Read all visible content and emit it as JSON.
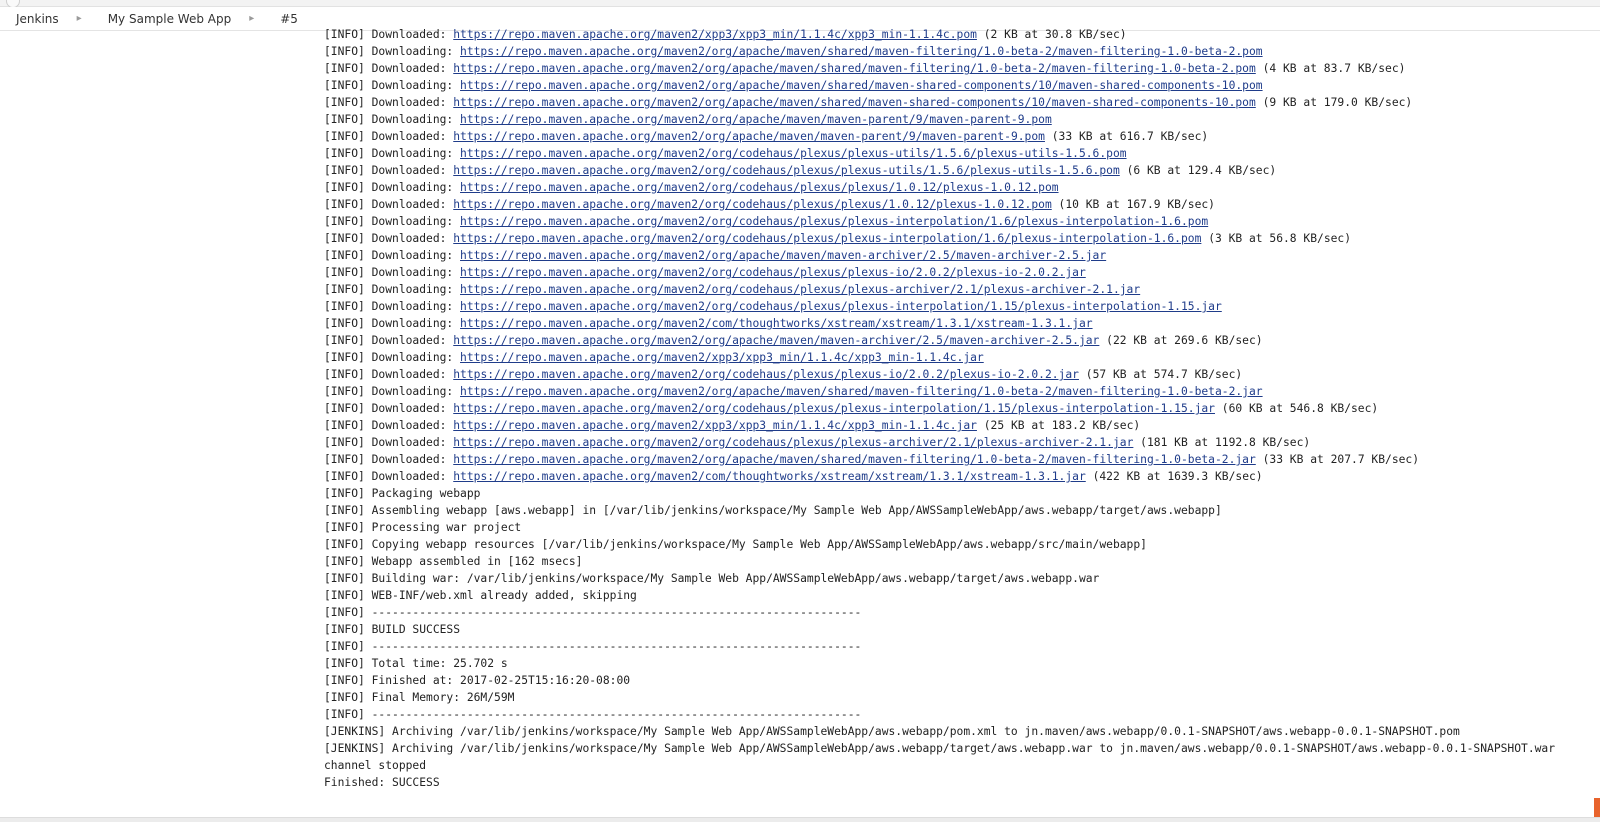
{
  "breadcrumbs": [
    "Jenkins",
    "My Sample Web App",
    "#5"
  ],
  "console": [
    {
      "prefix": "[INFO] Downloaded: ",
      "link": "https://repo.maven.apache.org/maven2/xpp3/xpp3_min/1.1.4c/xpp3_min-1.1.4c.pom",
      "suffix": " (2 KB at 30.8 KB/sec)"
    },
    {
      "prefix": "[INFO] Downloading: ",
      "link": "https://repo.maven.apache.org/maven2/org/apache/maven/shared/maven-filtering/1.0-beta-2/maven-filtering-1.0-beta-2.pom",
      "suffix": ""
    },
    {
      "prefix": "[INFO] Downloaded: ",
      "link": "https://repo.maven.apache.org/maven2/org/apache/maven/shared/maven-filtering/1.0-beta-2/maven-filtering-1.0-beta-2.pom",
      "suffix": " (4 KB at 83.7 KB/sec)"
    },
    {
      "prefix": "[INFO] Downloading: ",
      "link": "https://repo.maven.apache.org/maven2/org/apache/maven/shared/maven-shared-components/10/maven-shared-components-10.pom",
      "suffix": ""
    },
    {
      "prefix": "[INFO] Downloaded: ",
      "link": "https://repo.maven.apache.org/maven2/org/apache/maven/shared/maven-shared-components/10/maven-shared-components-10.pom",
      "suffix": " (9 KB at 179.0 KB/sec)"
    },
    {
      "prefix": "[INFO] Downloading: ",
      "link": "https://repo.maven.apache.org/maven2/org/apache/maven/maven-parent/9/maven-parent-9.pom",
      "suffix": ""
    },
    {
      "prefix": "[INFO] Downloaded: ",
      "link": "https://repo.maven.apache.org/maven2/org/apache/maven/maven-parent/9/maven-parent-9.pom",
      "suffix": " (33 KB at 616.7 KB/sec)"
    },
    {
      "prefix": "[INFO] Downloading: ",
      "link": "https://repo.maven.apache.org/maven2/org/codehaus/plexus/plexus-utils/1.5.6/plexus-utils-1.5.6.pom",
      "suffix": ""
    },
    {
      "prefix": "[INFO] Downloaded: ",
      "link": "https://repo.maven.apache.org/maven2/org/codehaus/plexus/plexus-utils/1.5.6/plexus-utils-1.5.6.pom",
      "suffix": " (6 KB at 129.4 KB/sec)"
    },
    {
      "prefix": "[INFO] Downloading: ",
      "link": "https://repo.maven.apache.org/maven2/org/codehaus/plexus/plexus/1.0.12/plexus-1.0.12.pom",
      "suffix": ""
    },
    {
      "prefix": "[INFO] Downloaded: ",
      "link": "https://repo.maven.apache.org/maven2/org/codehaus/plexus/plexus/1.0.12/plexus-1.0.12.pom",
      "suffix": " (10 KB at 167.9 KB/sec)"
    },
    {
      "prefix": "[INFO] Downloading: ",
      "link": "https://repo.maven.apache.org/maven2/org/codehaus/plexus/plexus-interpolation/1.6/plexus-interpolation-1.6.pom",
      "suffix": ""
    },
    {
      "prefix": "[INFO] Downloaded: ",
      "link": "https://repo.maven.apache.org/maven2/org/codehaus/plexus/plexus-interpolation/1.6/plexus-interpolation-1.6.pom",
      "suffix": " (3 KB at 56.8 KB/sec)"
    },
    {
      "prefix": "[INFO] Downloading: ",
      "link": "https://repo.maven.apache.org/maven2/org/apache/maven/maven-archiver/2.5/maven-archiver-2.5.jar",
      "suffix": ""
    },
    {
      "prefix": "[INFO] Downloading: ",
      "link": "https://repo.maven.apache.org/maven2/org/codehaus/plexus/plexus-io/2.0.2/plexus-io-2.0.2.jar",
      "suffix": ""
    },
    {
      "prefix": "[INFO] Downloading: ",
      "link": "https://repo.maven.apache.org/maven2/org/codehaus/plexus/plexus-archiver/2.1/plexus-archiver-2.1.jar",
      "suffix": ""
    },
    {
      "prefix": "[INFO] Downloading: ",
      "link": "https://repo.maven.apache.org/maven2/org/codehaus/plexus/plexus-interpolation/1.15/plexus-interpolation-1.15.jar",
      "suffix": ""
    },
    {
      "prefix": "[INFO] Downloading: ",
      "link": "https://repo.maven.apache.org/maven2/com/thoughtworks/xstream/xstream/1.3.1/xstream-1.3.1.jar",
      "suffix": ""
    },
    {
      "prefix": "[INFO] Downloaded: ",
      "link": "https://repo.maven.apache.org/maven2/org/apache/maven/maven-archiver/2.5/maven-archiver-2.5.jar",
      "suffix": " (22 KB at 269.6 KB/sec)"
    },
    {
      "prefix": "[INFO] Downloading: ",
      "link": "https://repo.maven.apache.org/maven2/xpp3/xpp3_min/1.1.4c/xpp3_min-1.1.4c.jar",
      "suffix": ""
    },
    {
      "prefix": "[INFO] Downloaded: ",
      "link": "https://repo.maven.apache.org/maven2/org/codehaus/plexus/plexus-io/2.0.2/plexus-io-2.0.2.jar",
      "suffix": " (57 KB at 574.7 KB/sec)"
    },
    {
      "prefix": "[INFO] Downloading: ",
      "link": "https://repo.maven.apache.org/maven2/org/apache/maven/shared/maven-filtering/1.0-beta-2/maven-filtering-1.0-beta-2.jar",
      "suffix": ""
    },
    {
      "prefix": "[INFO] Downloaded: ",
      "link": "https://repo.maven.apache.org/maven2/org/codehaus/plexus/plexus-interpolation/1.15/plexus-interpolation-1.15.jar",
      "suffix": " (60 KB at 546.8 KB/sec)"
    },
    {
      "prefix": "[INFO] Downloaded: ",
      "link": "https://repo.maven.apache.org/maven2/xpp3/xpp3_min/1.1.4c/xpp3_min-1.1.4c.jar",
      "suffix": " (25 KB at 183.2 KB/sec)"
    },
    {
      "prefix": "[INFO] Downloaded: ",
      "link": "https://repo.maven.apache.org/maven2/org/codehaus/plexus/plexus-archiver/2.1/plexus-archiver-2.1.jar",
      "suffix": " (181 KB at 1192.8 KB/sec)"
    },
    {
      "prefix": "[INFO] Downloaded: ",
      "link": "https://repo.maven.apache.org/maven2/org/apache/maven/shared/maven-filtering/1.0-beta-2/maven-filtering-1.0-beta-2.jar",
      "suffix": " (33 KB at 207.7 KB/sec)"
    },
    {
      "prefix": "[INFO] Downloaded: ",
      "link": "https://repo.maven.apache.org/maven2/com/thoughtworks/xstream/xstream/1.3.1/xstream-1.3.1.jar",
      "suffix": " (422 KB at 1639.3 KB/sec)"
    },
    {
      "prefix": "[INFO] Packaging webapp",
      "link": "",
      "suffix": ""
    },
    {
      "prefix": "[INFO] Assembling webapp [aws.webapp] in [/var/lib/jenkins/workspace/My Sample Web App/AWSSampleWebApp/aws.webapp/target/aws.webapp]",
      "link": "",
      "suffix": ""
    },
    {
      "prefix": "[INFO] Processing war project",
      "link": "",
      "suffix": ""
    },
    {
      "prefix": "[INFO] Copying webapp resources [/var/lib/jenkins/workspace/My Sample Web App/AWSSampleWebApp/aws.webapp/src/main/webapp]",
      "link": "",
      "suffix": ""
    },
    {
      "prefix": "[INFO] Webapp assembled in [162 msecs]",
      "link": "",
      "suffix": ""
    },
    {
      "prefix": "[INFO] Building war: /var/lib/jenkins/workspace/My Sample Web App/AWSSampleWebApp/aws.webapp/target/aws.webapp.war",
      "link": "",
      "suffix": ""
    },
    {
      "prefix": "[INFO] WEB-INF/web.xml already added, skipping",
      "link": "",
      "suffix": ""
    },
    {
      "prefix": "[INFO] ------------------------------------------------------------------------",
      "link": "",
      "suffix": ""
    },
    {
      "prefix": "[INFO] BUILD SUCCESS",
      "link": "",
      "suffix": ""
    },
    {
      "prefix": "[INFO] ------------------------------------------------------------------------",
      "link": "",
      "suffix": ""
    },
    {
      "prefix": "[INFO] Total time: 25.702 s",
      "link": "",
      "suffix": ""
    },
    {
      "prefix": "[INFO] Finished at: 2017-02-25T15:16:20-08:00",
      "link": "",
      "suffix": ""
    },
    {
      "prefix": "[INFO] Final Memory: 26M/59M",
      "link": "",
      "suffix": ""
    },
    {
      "prefix": "[INFO] ------------------------------------------------------------------------",
      "link": "",
      "suffix": ""
    },
    {
      "prefix": "[JENKINS] Archiving /var/lib/jenkins/workspace/My Sample Web App/AWSSampleWebApp/aws.webapp/pom.xml to jn.maven/aws.webapp/0.0.1-SNAPSHOT/aws.webapp-0.0.1-SNAPSHOT.pom",
      "link": "",
      "suffix": ""
    },
    {
      "prefix": "[JENKINS] Archiving /var/lib/jenkins/workspace/My Sample Web App/AWSSampleWebApp/aws.webapp/target/aws.webapp.war to jn.maven/aws.webapp/0.0.1-SNAPSHOT/aws.webapp-0.0.1-SNAPSHOT.war",
      "link": "",
      "suffix": ""
    },
    {
      "prefix": "channel stopped",
      "link": "",
      "suffix": ""
    },
    {
      "prefix": "Finished: SUCCESS",
      "link": "",
      "suffix": ""
    }
  ]
}
